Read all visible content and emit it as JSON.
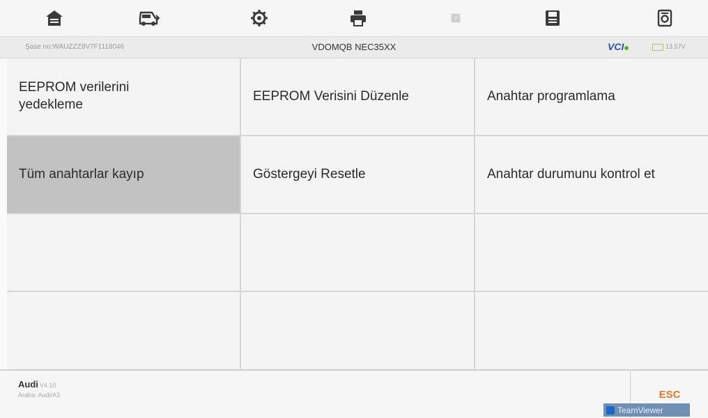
{
  "toolbar": {
    "icons": [
      "home-icon",
      "vehicle-icon",
      "settings-icon",
      "print-icon",
      "help-icon",
      "save-icon",
      "screenshot-icon"
    ]
  },
  "info_bar": {
    "vin": "Şase no:WAUZZZ8V7F1118046",
    "model": "VDOMQB NEC35XX",
    "vci": "VCI",
    "battery": "13.57V"
  },
  "menu": {
    "items": [
      {
        "label": "EEPROM verilerini yedekleme",
        "selected": false
      },
      {
        "label": "EEPROM Verisini Düzenle",
        "selected": false
      },
      {
        "label": "Anahtar programlama",
        "selected": false
      },
      {
        "label": "Tüm anahtarlar kayıp",
        "selected": true
      },
      {
        "label": "Göstergeyi Resetle",
        "selected": false
      },
      {
        "label": "Anahtar durumunu kontrol et",
        "selected": false
      }
    ]
  },
  "footer": {
    "brand": "Audi",
    "version": "V4.10",
    "vehicle": "Araba: Audi/A3",
    "esc_label": "ESC"
  },
  "teamviewer": {
    "label": "TeamViewer"
  },
  "colors": {
    "accent": "#e07a27",
    "selected_cell": "#c2c2c2",
    "cell_bg": "#f4f4f4",
    "vci_blue": "#2f4fa0",
    "vci_green": "#5cb030"
  }
}
